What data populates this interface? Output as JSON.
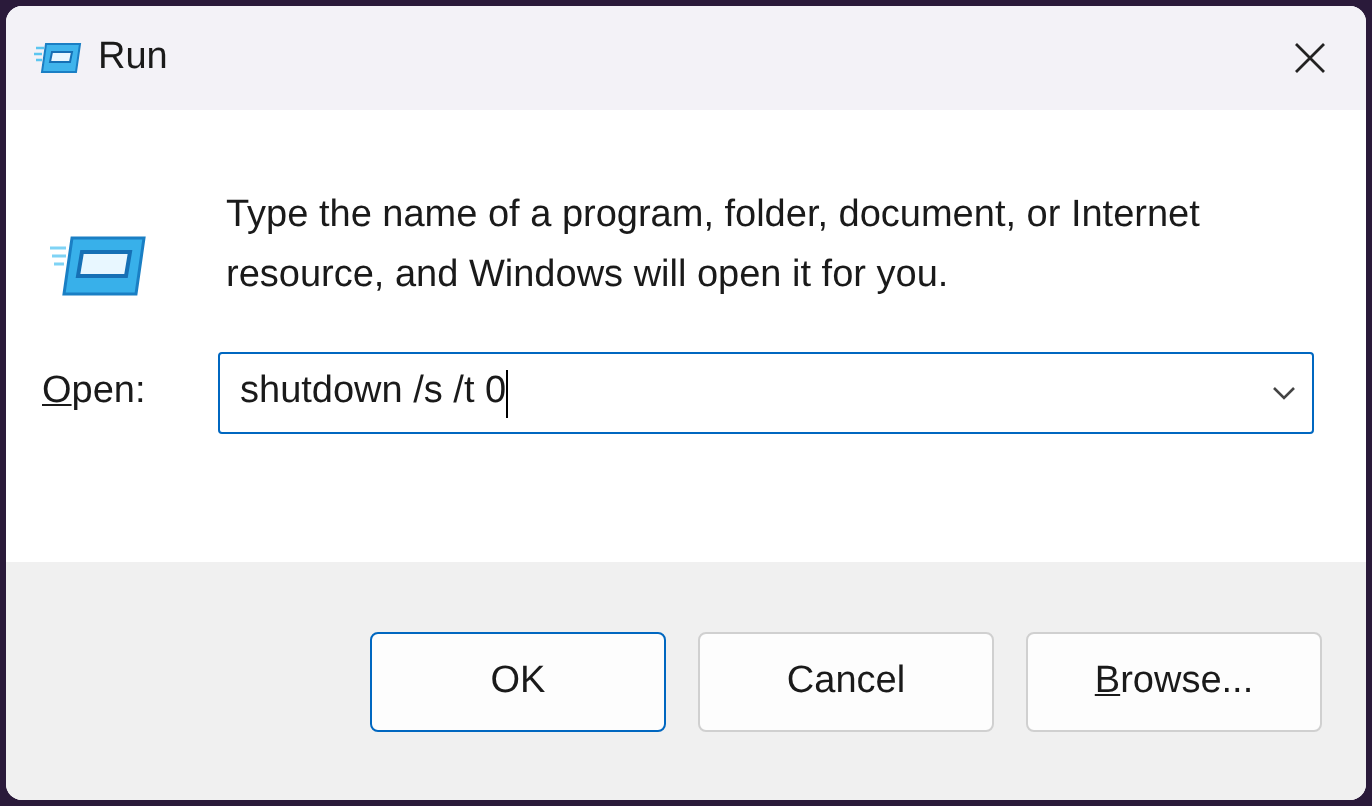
{
  "window": {
    "title": "Run"
  },
  "message": "Type the name of a program, folder, document, or Internet resource, and Windows will open it for you.",
  "open_field": {
    "label": "Open:",
    "mnemonic_underlined": true,
    "value": "shutdown /s /t 0",
    "focused": true
  },
  "buttons": [
    {
      "label": "OK",
      "default": true,
      "mnemonic_underlined": false
    },
    {
      "label": "Cancel",
      "default": false,
      "mnemonic_underlined": false
    },
    {
      "label": "Browse...",
      "default": false,
      "mnemonic_underlined": true
    }
  ]
}
